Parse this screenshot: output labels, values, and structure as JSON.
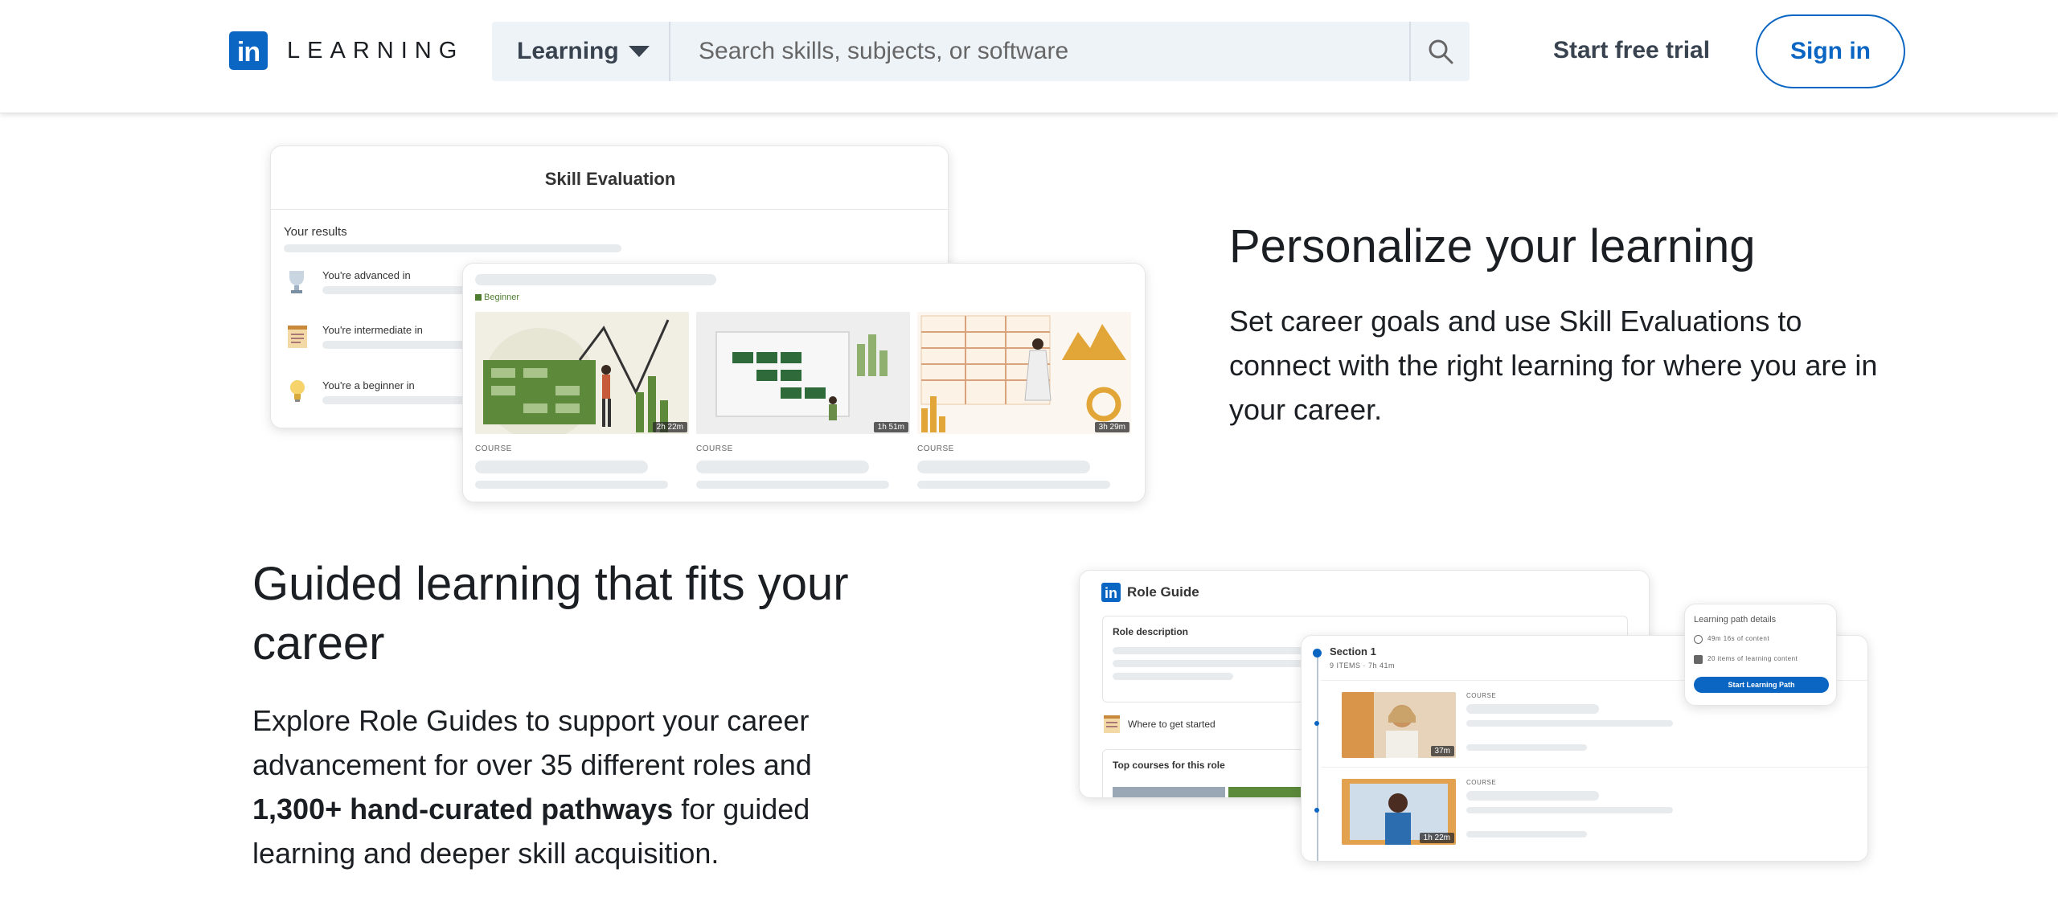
{
  "header": {
    "logo_letters": "in",
    "logo_text": "LEARNING",
    "search_category": "Learning",
    "search_placeholder": "Search skills, subjects, or software",
    "start_trial": "Start free trial",
    "sign_in": "Sign in"
  },
  "section1": {
    "heading": "Personalize your learning",
    "body": "Set career goals and use Skill Evaluations to connect with the right learning for where you are in your career.",
    "illustration": {
      "card_title": "Skill Evaluation",
      "results_label": "Your results",
      "rows": [
        "You're advanced in",
        "You're intermediate in",
        "You're a beginner in"
      ],
      "beginner_badge": "Beginner",
      "courses": [
        {
          "label": "COURSE",
          "duration": "2h 22m"
        },
        {
          "label": "COURSE",
          "duration": "1h 51m"
        },
        {
          "label": "COURSE",
          "duration": "3h 29m"
        }
      ]
    }
  },
  "section2": {
    "heading": "Guided learning that fits your career",
    "body_before": "Explore Role Guides to support your career advancement for over 35 different roles and ",
    "body_bold": "1,300+ hand-curated pathways",
    "body_after": " for guided learning and deeper skill acquisition.",
    "illustration": {
      "logo_letters": "in",
      "card_title": "Role Guide",
      "role_description": "Role description",
      "where_to_start": "Where to get started",
      "top_courses": "Top courses for this role",
      "section_title": "Section 1",
      "section_meta": "9 ITEMS · 7h 41m",
      "path_title": "Learning path details",
      "path_content": "49m 16s of content",
      "path_items": "20 items of learning content",
      "path_button": "Start Learning Path",
      "courses": [
        {
          "label": "COURSE",
          "duration": "37m"
        },
        {
          "label": "COURSE",
          "duration": "1h 22m"
        }
      ]
    }
  },
  "colors": {
    "brand": "#0a66c2",
    "search_bg": "#eef3f8",
    "text": "#1b1f23"
  }
}
